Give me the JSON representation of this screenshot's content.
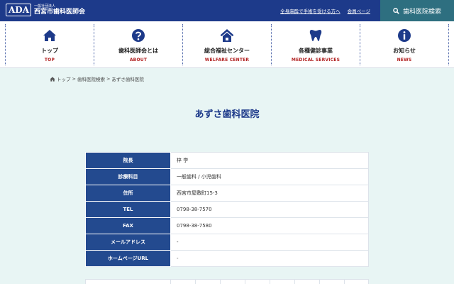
{
  "header": {
    "logo_mark": "ADA",
    "org_small": "一般社団法人",
    "org_name": "西宮市歯科医師会",
    "links": [
      "全身麻酔で手術を受ける方へ",
      "会員ページ"
    ],
    "search_label": "歯科医院検索"
  },
  "nav": [
    {
      "jp": "トップ",
      "en": "TOP",
      "icon": "home-icon"
    },
    {
      "jp": "歯科医師会とは",
      "en": "ABOUT",
      "icon": "question-icon"
    },
    {
      "jp": "総合福祉センター",
      "en": "WELFARE CENTER",
      "icon": "house-icon"
    },
    {
      "jp": "各種健診事業",
      "en": "MEDICAL SERVICES",
      "icon": "tooth-icon"
    },
    {
      "jp": "お知らせ",
      "en": "NEWS",
      "icon": "info-icon"
    }
  ],
  "breadcrumb": [
    "トップ",
    "歯科医院検索",
    "あずさ歯科医院"
  ],
  "page_title": "あずさ歯科医院",
  "info": [
    {
      "label": "院長",
      "value": "梓 学"
    },
    {
      "label": "診療科目",
      "value": "一般歯科 / 小児歯科"
    },
    {
      "label": "住所",
      "value": "西宮市屋敷町15-3"
    },
    {
      "label": "TEL",
      "value": "0798-38-7570"
    },
    {
      "label": "FAX",
      "value": "0798-38-7580"
    },
    {
      "label": "メールアドレス",
      "value": "-"
    },
    {
      "label": "ホームページURL",
      "value": "-"
    }
  ],
  "colors": {
    "navy": "#1d3a8a",
    "teal": "#2e6f80",
    "red": "#b22222",
    "bg": "#e8f5f4"
  }
}
